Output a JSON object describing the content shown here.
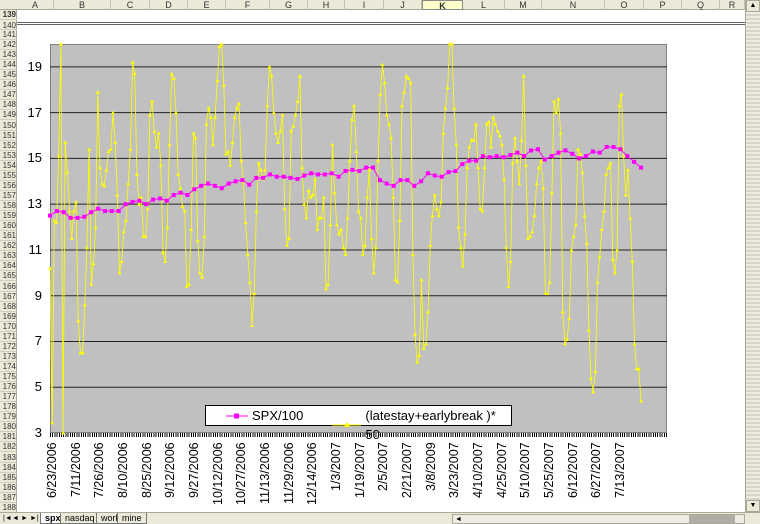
{
  "spreadsheet": {
    "columns": [
      "A",
      "B",
      "C",
      "D",
      "E",
      "F",
      "G",
      "H",
      "I",
      "J",
      "K",
      "L",
      "M",
      "N",
      "O",
      "P",
      "Q",
      "R"
    ],
    "selected_column": "K",
    "rows": [
      139,
      140,
      141,
      142,
      143,
      144,
      145,
      146,
      147,
      148,
      149,
      150,
      151,
      152,
      153,
      154,
      155,
      156,
      157,
      158,
      159,
      160,
      161,
      162,
      163,
      164,
      165,
      166,
      167,
      168,
      169,
      170,
      171,
      172,
      173,
      174,
      175,
      176,
      177,
      178,
      179,
      180,
      181,
      182,
      183,
      184,
      185,
      186,
      187,
      188
    ],
    "sheet_tabs": [
      {
        "label": "spx",
        "active": true
      },
      {
        "label": "nasdaq",
        "active": false
      },
      {
        "label": "work",
        "active": false
      },
      {
        "label": "mine",
        "active": false
      }
    ],
    "nav_icons": [
      "first-sheet-icon",
      "prev-sheet-icon",
      "next-sheet-icon",
      "last-sheet-icon"
    ]
  },
  "chart_data": {
    "type": "line",
    "title": "",
    "xlabel": "",
    "ylabel": "",
    "ylim": [
      3,
      20
    ],
    "yticks": [
      3,
      5,
      7,
      9,
      11,
      13,
      15,
      17,
      19
    ],
    "grid": true,
    "plot_background": "#c0c0c0",
    "legend_position": "bottom-center",
    "x_tick_labels": [
      "6/23/2006",
      "7/11/2006",
      "7/26/2006",
      "8/10/2006",
      "8/25/2006",
      "9/12/2006",
      "9/27/2006",
      "10/12/2006",
      "10/27/2006",
      "11/13/2006",
      "11/29/2006",
      "12/14/2006",
      "1/3/2007",
      "1/19/2007",
      "2/5/2007",
      "2/21/2007",
      "3/8/2009",
      "3/23/2007",
      "4/10/2007",
      "4/25/2007",
      "5/10/2007",
      "5/25/2007",
      "6/12/2007",
      "6/27/2007",
      "7/13/2007"
    ],
    "series": [
      {
        "name": "SPX/100",
        "color": "#ff00ff",
        "marker": "square",
        "values": [
          12.5,
          12.7,
          12.65,
          12.4,
          12.4,
          12.45,
          12.65,
          12.8,
          12.7,
          12.7,
          12.7,
          13.0,
          13.1,
          13.15,
          13.0,
          13.2,
          13.25,
          13.15,
          13.4,
          13.5,
          13.4,
          13.65,
          13.8,
          13.9,
          13.8,
          13.7,
          13.9,
          14.0,
          14.05,
          13.85,
          14.15,
          14.15,
          14.3,
          14.2,
          14.2,
          14.15,
          14.1,
          14.25,
          14.35,
          14.3,
          14.3,
          14.35,
          14.2,
          14.45,
          14.5,
          14.45,
          14.6,
          14.6,
          14.05,
          13.9,
          13.8,
          14.05,
          14.05,
          13.8,
          14.0,
          14.35,
          14.25,
          14.2,
          14.4,
          14.45,
          14.75,
          14.9,
          14.9,
          15.1,
          15.05,
          15.1,
          15.05,
          15.15,
          15.25,
          15.1,
          15.35,
          15.4,
          14.95,
          15.1,
          15.25,
          15.35,
          15.2,
          15.0,
          15.1,
          15.3,
          15.25,
          15.5,
          15.5,
          15.4,
          15.1,
          14.85,
          14.6
        ]
      },
      {
        "name": "(latestay+earlybreak )* 50",
        "color": "#ffff00",
        "marker": "triangle",
        "values": [
          10.2,
          3.45,
          12.3,
          12.2,
          15.1,
          20,
          3,
          15.7,
          14.4,
          12.7,
          11.5,
          12.7,
          13.1,
          7.9,
          6.5,
          6.5,
          8.6,
          11.1,
          15.4,
          9.5,
          10.4,
          12,
          17.9,
          14.6,
          13.9,
          13.8,
          14.5,
          15.3,
          15.4,
          17,
          15.7,
          13.4,
          10,
          10.5,
          11.8,
          12.3,
          13.9,
          15.4,
          19.2,
          18.7,
          14.3,
          13,
          13.3,
          11.6,
          11.6,
          12.8,
          16.9,
          17.5,
          16.2,
          15.5,
          16.1,
          14.7,
          10.9,
          10.5,
          12,
          15.6,
          18.7,
          18.5,
          17,
          14.3,
          13.7,
          12.9,
          12.7,
          9.4,
          9.5,
          11.9,
          16.1,
          15.9,
          11.4,
          10,
          9.8,
          11.6,
          16.5,
          17.2,
          16.8,
          15.6,
          16.8,
          18.4,
          19.9,
          20,
          18.2,
          15.2,
          15.3,
          14.7,
          15.7,
          16.8,
          17.2,
          17.4,
          14.9,
          14,
          12.2,
          10.8,
          9.6,
          7.7,
          9.1,
          12.7,
          14.8,
          14.5,
          14.1,
          14.5,
          17.3,
          19,
          18.6,
          17,
          16.1,
          15.7,
          16.2,
          16.9,
          12.8,
          11.2,
          11.5,
          16.2,
          16.4,
          16.9,
          17.5,
          18.6,
          14.6,
          13,
          12.4,
          13.6,
          13.3,
          13.4,
          14.1,
          11.9,
          12.4,
          12.4,
          13.3,
          9.3,
          9.5,
          12.1,
          15.6,
          13.5,
          12.1,
          11.7,
          11.9,
          11.1,
          10.8,
          12.4,
          14.9,
          16.7,
          17.3,
          15.3,
          12.7,
          12.4,
          10.8,
          11.2,
          13.3,
          14.5,
          11.5,
          10,
          11.1,
          14.9,
          17.8,
          19.1,
          18.3,
          16.9,
          16.5,
          15.9,
          13.3,
          9.7,
          9.6,
          12.3,
          17.3,
          17.9,
          18.6,
          18.5,
          18.3,
          10.8,
          7.3,
          6.1,
          6.4,
          9.7,
          6.7,
          6.9,
          8.3,
          11.2,
          12.5,
          13.4,
          12.8,
          12.5,
          13.1,
          16.1,
          17.2,
          18.1,
          20,
          20,
          17.2,
          15.6,
          12,
          11.1,
          10.3,
          11.7,
          14.6,
          15.5,
          15.8,
          15.8,
          16.5,
          14.6,
          12.8,
          12.7,
          14.6,
          16.5,
          16.6,
          15.5,
          16.8,
          16.5,
          16.2,
          16,
          15.6,
          14.1,
          11.1,
          9.4,
          10.5,
          14.8,
          15.9,
          14.9,
          13.9,
          15.8,
          18.6,
          14.7,
          11.5,
          11.6,
          11.8,
          12.5,
          13.9,
          14.6,
          14.9,
          13.7,
          9.1,
          9.1,
          9.6,
          13.5,
          17.5,
          17,
          17.6,
          16.1,
          8.3,
          6.9,
          7.1,
          8,
          11,
          11.6,
          12.1,
          15.4,
          15.2,
          14.4,
          12.5,
          11.3,
          7.5,
          5.4,
          4.8,
          5.7,
          9.6,
          10.7,
          11.9,
          12.7,
          14.3,
          14.6,
          14.8,
          10.6,
          10,
          11,
          17.3,
          17.8,
          15.1,
          13.4,
          14.5,
          12.4,
          10.5,
          6.9,
          5.8,
          5.8,
          4.4
        ]
      }
    ]
  }
}
